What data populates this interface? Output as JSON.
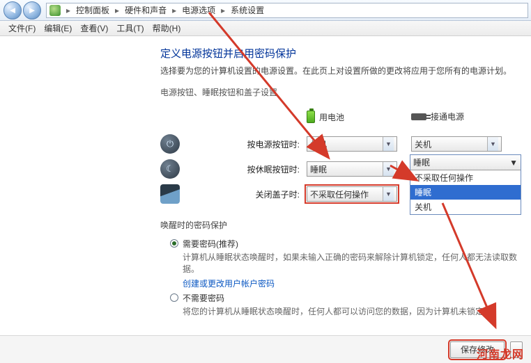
{
  "breadcrumb": {
    "items": [
      "控制面板",
      "硬件和声音",
      "电源选项",
      "系统设置"
    ]
  },
  "menu": {
    "items": [
      "文件(F)",
      "编辑(E)",
      "查看(V)",
      "工具(T)",
      "帮助(H)"
    ]
  },
  "page": {
    "title": "定义电源按钮并启用密码保护",
    "desc": "选择要为您的计算机设置的电源设置。在此页上对设置所做的更改将应用于您所有的电源计划。",
    "section_label": "电源按钮、睡眠按钮和盖子设置"
  },
  "columns": {
    "battery": "用电池",
    "ac": "接通电源"
  },
  "rows": {
    "power_btn": {
      "label": "按电源按钮时:",
      "battery": "关机",
      "ac": "关机"
    },
    "sleep_btn": {
      "label": "按休眠按钮时:",
      "battery": "睡眠",
      "ac": "睡眠"
    },
    "lid": {
      "label": "关闭盖子时:",
      "battery": "不采取任何操作",
      "ac": "睡眠"
    }
  },
  "dropdown": {
    "current": "睡眠",
    "options": [
      "不采取任何操作",
      "睡眠",
      "关机"
    ],
    "selected_index": 1
  },
  "password": {
    "heading": "唤醒时的密码保护",
    "opt_need": "需要密码(推荐)",
    "opt_need_desc": "计算机从睡眠状态唤醒时，如果未输入正确的密码来解除计算机锁定，任何人都无法读取数据。",
    "link": "创建或更改用户帐户密码",
    "opt_noneed": "不需要密码",
    "opt_noneed_desc": "将您的计算机从睡眠状态唤醒时，任何人都可以访问您的数据，因为计算机未锁定。"
  },
  "footer": {
    "save": "保存修改"
  },
  "watermark": "河南龙网"
}
